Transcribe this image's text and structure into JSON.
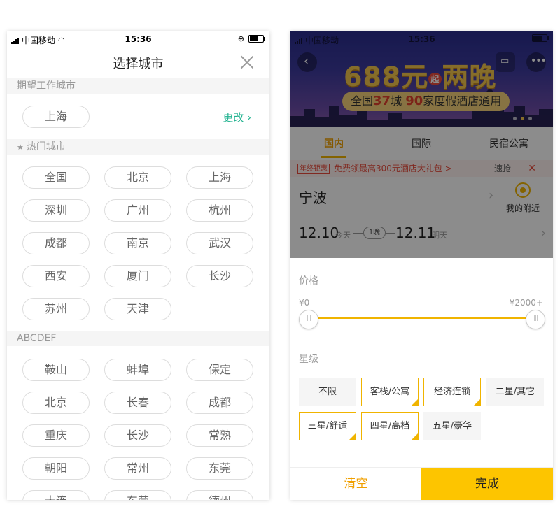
{
  "status_bar": {
    "carrier": "中国移动",
    "time": "15:36"
  },
  "left": {
    "title": "选择城市",
    "expected_section": "期望工作城市",
    "current_city": "上海",
    "change_label": "更改",
    "hot_section": "热门城市",
    "hot_cities": [
      "全国",
      "北京",
      "上海",
      "深圳",
      "广州",
      "杭州",
      "成都",
      "南京",
      "武汉",
      "西安",
      "厦门",
      "长沙",
      "苏州",
      "天津"
    ],
    "alpha_section": "ABCDEF",
    "alpha_cities": [
      "鞍山",
      "蚌埠",
      "保定",
      "北京",
      "长春",
      "成都",
      "重庆",
      "长沙",
      "常熟",
      "朝阳",
      "常州",
      "东莞",
      "大连",
      "东营",
      "德州"
    ]
  },
  "right": {
    "banner": {
      "headline": "688元",
      "badge": "起",
      "headline2": "两晚",
      "sub_prefix": "全国",
      "num_cities": "37",
      "city_word": "城",
      "num_hotels": "90",
      "sub_suffix": "家度假酒店通用"
    },
    "tabs": [
      "国内",
      "国际",
      "民宿公寓"
    ],
    "promo": {
      "tag": "年终钜惠",
      "text": "免费领最高300元酒店大礼包 >",
      "grab": "速抢",
      "close": "✕"
    },
    "city": "宁波",
    "nearby": "我的附近",
    "date_in": "12.10",
    "date_in_label": "今天",
    "nights": "1晚",
    "date_out": "12.11",
    "date_out_label": "明天",
    "price_label": "价格",
    "price_min": "¥0",
    "price_max": "¥2000+",
    "price_range": [
      0,
      1
    ],
    "star_label": "星级",
    "star_options": [
      {
        "label": "不限",
        "selected": false
      },
      {
        "label": "客栈/公寓",
        "selected": true
      },
      {
        "label": "经济连锁",
        "selected": true
      },
      {
        "label": "二星/其它",
        "selected": false
      },
      {
        "label": "三星/舒适",
        "selected": true
      },
      {
        "label": "四星/高档",
        "selected": true
      },
      {
        "label": "五星/豪华",
        "selected": false
      }
    ],
    "clear_label": "清空",
    "done_label": "完成"
  },
  "colors": {
    "accent": "#f0b400",
    "teal": "#21b28f",
    "promo_red": "#e94b3c",
    "done_bg": "#fdc500"
  }
}
